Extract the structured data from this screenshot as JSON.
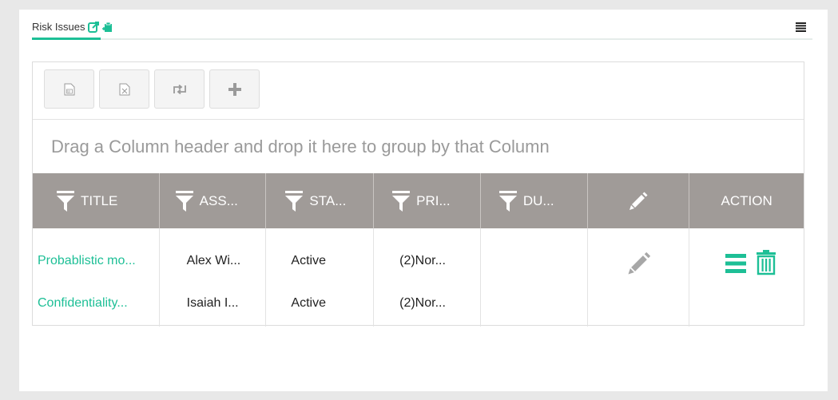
{
  "panel": {
    "title": "Risk Issues",
    "icons": [
      "external-edit-icon",
      "clipboard-icon"
    ],
    "menu_icon": "hamburger-icon"
  },
  "toolbar": {
    "buttons": [
      "export-word-icon",
      "export-excel-icon",
      "refresh-icon",
      "add-icon"
    ]
  },
  "group_bar": {
    "text": "Drag a Column header and drop it here to group by that Column"
  },
  "table": {
    "headers": [
      "TITLE",
      "ASS...",
      "STA...",
      "PRI...",
      "DU...",
      "",
      "ACTION"
    ],
    "rows": [
      {
        "title": "Probablistic mo...",
        "assignee": "Alex Wi...",
        "status": "Active",
        "priority": "(2)Nor...",
        "due": ""
      },
      {
        "title": "Confidentiality...",
        "assignee": "Isaiah I...",
        "status": "Active",
        "priority": "(2)Nor...",
        "due": ""
      }
    ]
  },
  "colors": {
    "accent": "#1dbf96",
    "header_bg": "#a09b98",
    "page_bg": "#e8e8e8"
  }
}
